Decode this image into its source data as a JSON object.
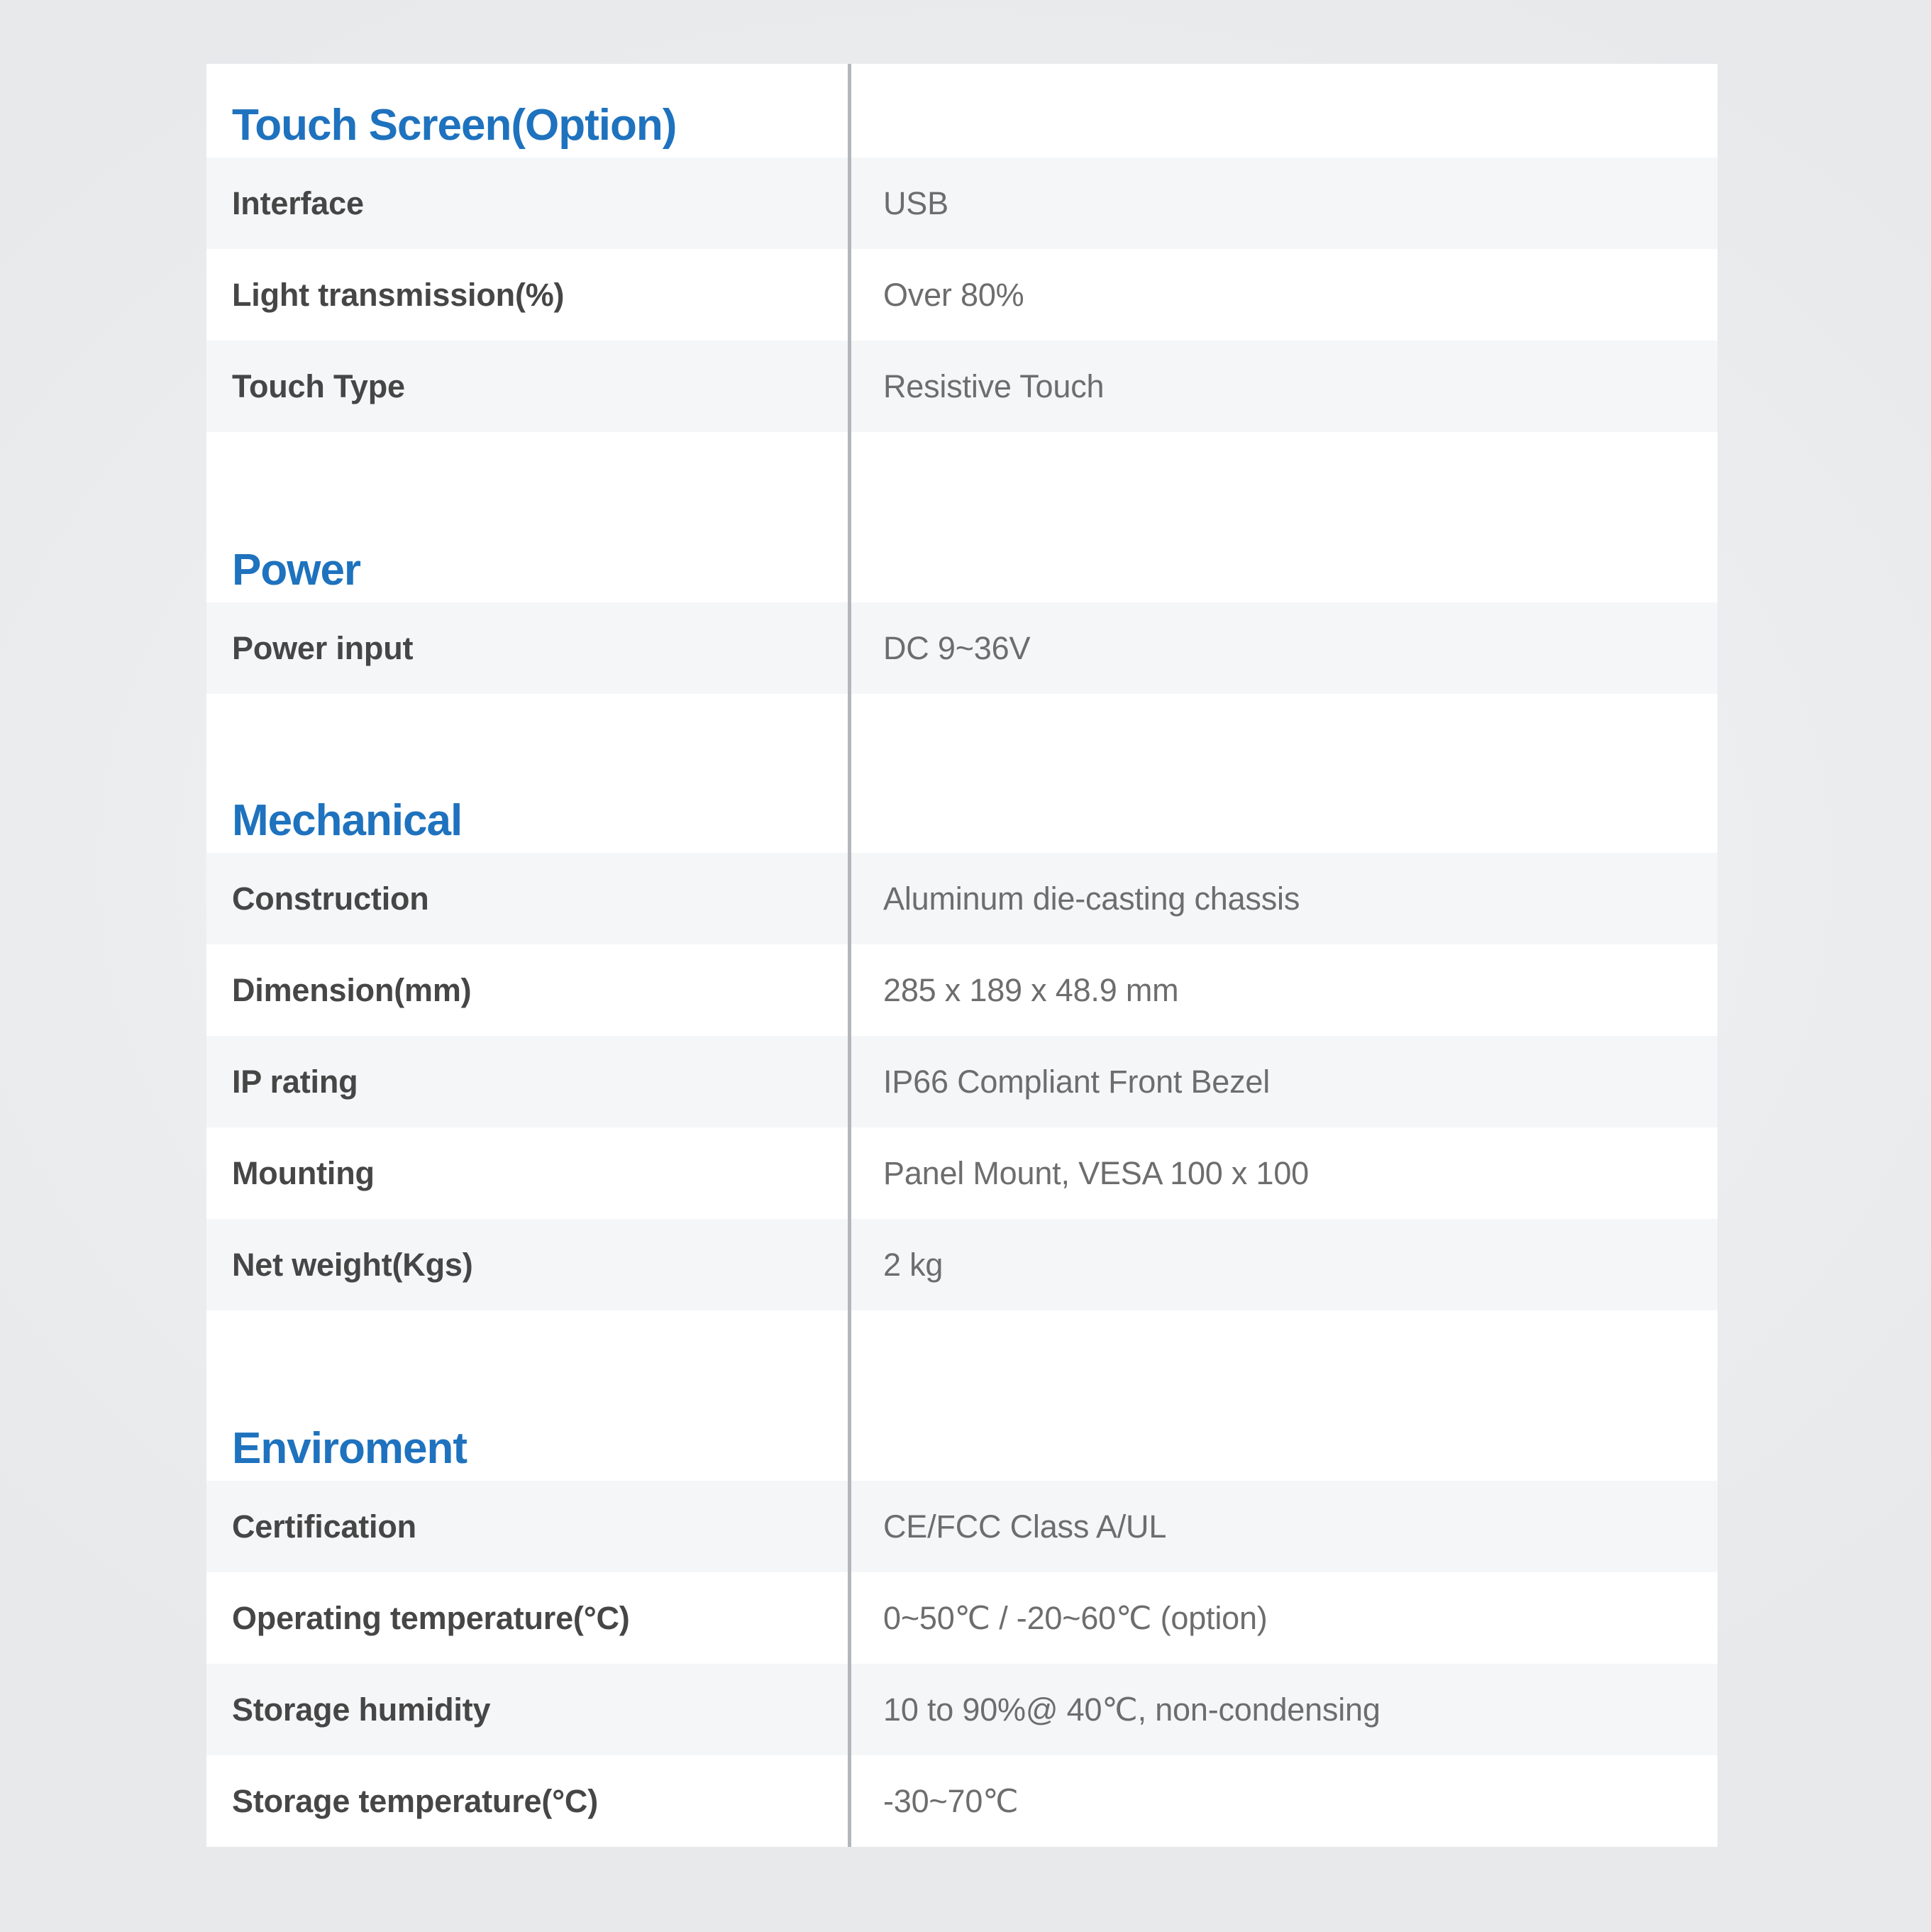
{
  "document": {
    "type": "product-specification-table",
    "columns": [
      "Specification",
      "Value"
    ],
    "accent_color": "#1e72be",
    "label_color": "#464646",
    "value_color": "#6d6d6d",
    "row_shade_color": "#f5f6f8",
    "row_base_color": "#ffffff",
    "divider_color": "#b3b7bb",
    "page_background": "#eceef0"
  },
  "rows": [
    {
      "kind": "section",
      "title": "Touch Screen(Option)",
      "shade": "white"
    },
    {
      "kind": "data",
      "label": "Interface",
      "value": "USB",
      "shade": "gray"
    },
    {
      "kind": "data",
      "label": "Light transmission(%)",
      "value": "Over 80%",
      "shade": "white"
    },
    {
      "kind": "data",
      "label": "Touch Type",
      "value": "Resistive Touch",
      "shade": "gray"
    },
    {
      "kind": "spacer",
      "label": "",
      "value": "",
      "shade": "white"
    },
    {
      "kind": "section",
      "title": "Power",
      "shade": "white"
    },
    {
      "kind": "data",
      "label": "Power input",
      "value": "DC 9~36V",
      "shade": "gray"
    },
    {
      "kind": "spacer",
      "label": "",
      "value": "",
      "shade": "white"
    },
    {
      "kind": "section",
      "title": "Mechanical",
      "shade": "white"
    },
    {
      "kind": "data",
      "label": "Construction",
      "value": "Aluminum die-casting chassis",
      "shade": "gray"
    },
    {
      "kind": "data",
      "label": "Dimension(mm)",
      "value": "285 x 189 x 48.9 mm",
      "shade": "white"
    },
    {
      "kind": "data",
      "label": "IP rating",
      "value": "IP66 Compliant Front Bezel",
      "shade": "gray"
    },
    {
      "kind": "data",
      "label": "Mounting",
      "value": "Panel Mount, VESA 100 x 100",
      "shade": "white"
    },
    {
      "kind": "data",
      "label": "Net weight(Kgs)",
      "value": "2 kg",
      "shade": "gray"
    },
    {
      "kind": "spacer",
      "label": "",
      "value": "",
      "shade": "white"
    },
    {
      "kind": "section",
      "title": "Enviroment",
      "shade": "white"
    },
    {
      "kind": "data",
      "label": "Certification",
      "value": "CE/FCC Class A/UL",
      "shade": "gray"
    },
    {
      "kind": "data",
      "label": "Operating temperature(°C)",
      "value": "0~50℃ / -20~60℃ (option)",
      "shade": "white"
    },
    {
      "kind": "data",
      "label": "Storage humidity",
      "value": "10 to 90%@ 40℃, non-condensing",
      "shade": "gray"
    },
    {
      "kind": "data",
      "label": "Storage temperature(°C)",
      "value": "-30~70℃",
      "shade": "white"
    }
  ]
}
